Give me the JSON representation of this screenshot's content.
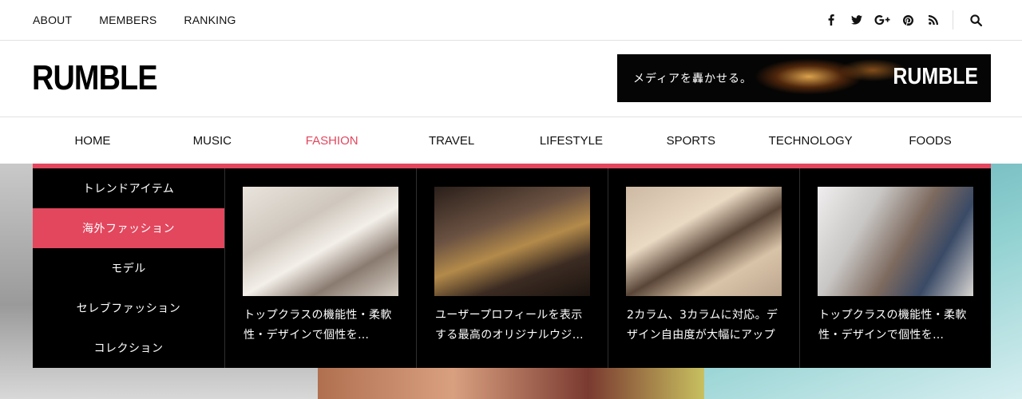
{
  "topnav": {
    "links": [
      "ABOUT",
      "MEMBERS",
      "RANKING"
    ]
  },
  "social": {
    "icons": [
      "facebook-icon",
      "twitter-icon",
      "google-plus-icon",
      "pinterest-icon",
      "rss-icon"
    ],
    "search_icon": "search-icon"
  },
  "header": {
    "logo": "RUMBLE",
    "banner": {
      "tagline": "メディアを轟かせる。",
      "logo": "RUMBLE"
    }
  },
  "mainnav": {
    "items": [
      "HOME",
      "MUSIC",
      "FASHION",
      "TRAVEL",
      "LIFESTYLE",
      "SPORTS",
      "TECHNOLOGY",
      "FOODS"
    ],
    "active": "FASHION"
  },
  "megamenu": {
    "categories": [
      "トレンドアイテム",
      "海外ファッション",
      "モデル",
      "セレブファッション",
      "コレクション"
    ],
    "active_category": "海外ファッション",
    "posts": [
      {
        "line1": "トップクラスの機能性・柔軟",
        "line2": "性・デザインで個性を…"
      },
      {
        "line1": "ユーザープロフィールを表示",
        "line2": "する最高のオリジナルウジ…"
      },
      {
        "line1": "2カラム、3カラムに対応。デ",
        "line2": "ザイン自由度が大幅にアップ"
      },
      {
        "line1": "トップクラスの機能性・柔軟",
        "line2": "性・デザインで個性を…"
      }
    ]
  },
  "colors": {
    "accent": "#e2475e",
    "menu_bg": "#000000"
  }
}
